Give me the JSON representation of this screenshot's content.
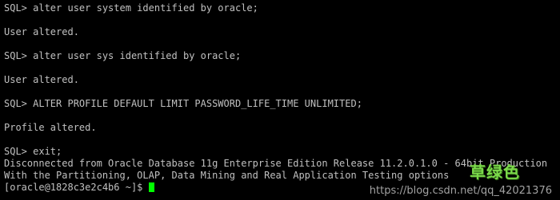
{
  "terminal": {
    "lines": [
      "SQL> alter user system identified by oracle;",
      "",
      "User altered.",
      "",
      "SQL> alter user sys identified by oracle;",
      "",
      "User altered.",
      "",
      "SQL> ALTER PROFILE DEFAULT LIMIT PASSWORD_LIFE_TIME UNLIMITED;",
      "",
      "Profile altered.",
      "",
      "SQL> exit;",
      "Disconnected from Oracle Database 11g Enterprise Edition Release 11.2.0.1.0 - 64bit Production",
      "With the Partitioning, OLAP, Data Mining and Real Application Testing options"
    ],
    "prompt": "[oracle@1828c3e2c4b6 ~]$ ",
    "colors": {
      "background": "#000000",
      "foreground": "#c0c0c0",
      "cursor": "#00ff00"
    }
  },
  "watermark": {
    "logo": "草绿色",
    "url": "https://blog.csdn.net/qq_42021376"
  }
}
